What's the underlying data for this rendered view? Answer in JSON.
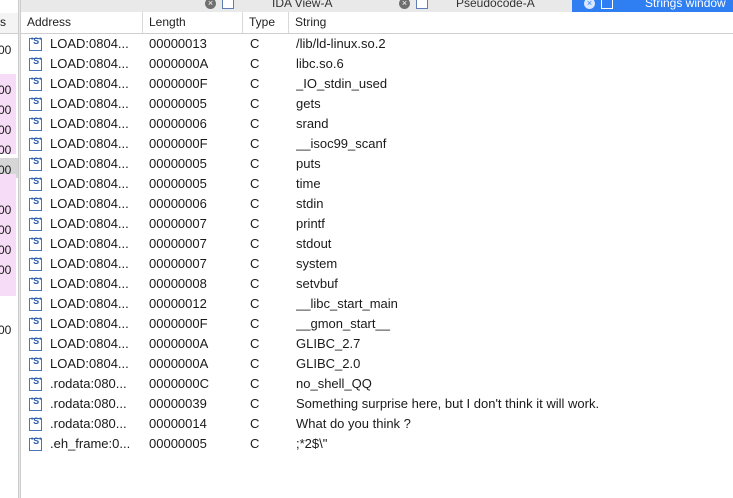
{
  "left_pane": {
    "header_fragment": "s",
    "fragments": [
      "00",
      "00",
      "00",
      "00",
      "00",
      "00",
      "00",
      "00",
      "00",
      "00",
      "00"
    ]
  },
  "tabs": [
    {
      "label": "IDA View-A",
      "close": "×"
    },
    {
      "label": "Pseudocode-A",
      "close": "×"
    },
    {
      "label": "Strings window",
      "close": "×",
      "active": true
    }
  ],
  "columns": {
    "address": "Address",
    "length": "Length",
    "type": "Type",
    "string": "String"
  },
  "rows": [
    {
      "address": "LOAD:0804...",
      "length": "00000013",
      "type": "C",
      "string": "/lib/ld-linux.so.2"
    },
    {
      "address": "LOAD:0804...",
      "length": "0000000A",
      "type": "C",
      "string": "libc.so.6"
    },
    {
      "address": "LOAD:0804...",
      "length": "0000000F",
      "type": "C",
      "string": "_IO_stdin_used"
    },
    {
      "address": "LOAD:0804...",
      "length": "00000005",
      "type": "C",
      "string": "gets"
    },
    {
      "address": "LOAD:0804...",
      "length": "00000006",
      "type": "C",
      "string": "srand"
    },
    {
      "address": "LOAD:0804...",
      "length": "0000000F",
      "type": "C",
      "string": "__isoc99_scanf"
    },
    {
      "address": "LOAD:0804...",
      "length": "00000005",
      "type": "C",
      "string": "puts"
    },
    {
      "address": "LOAD:0804...",
      "length": "00000005",
      "type": "C",
      "string": "time"
    },
    {
      "address": "LOAD:0804...",
      "length": "00000006",
      "type": "C",
      "string": "stdin"
    },
    {
      "address": "LOAD:0804...",
      "length": "00000007",
      "type": "C",
      "string": "printf"
    },
    {
      "address": "LOAD:0804...",
      "length": "00000007",
      "type": "C",
      "string": "stdout"
    },
    {
      "address": "LOAD:0804...",
      "length": "00000007",
      "type": "C",
      "string": "system"
    },
    {
      "address": "LOAD:0804...",
      "length": "00000008",
      "type": "C",
      "string": "setvbuf"
    },
    {
      "address": "LOAD:0804...",
      "length": "00000012",
      "type": "C",
      "string": "__libc_start_main"
    },
    {
      "address": "LOAD:0804...",
      "length": "0000000F",
      "type": "C",
      "string": "__gmon_start__"
    },
    {
      "address": "LOAD:0804...",
      "length": "0000000A",
      "type": "C",
      "string": "GLIBC_2.7"
    },
    {
      "address": "LOAD:0804...",
      "length": "0000000A",
      "type": "C",
      "string": "GLIBC_2.0"
    },
    {
      "address": ".rodata:080...",
      "length": "0000000C",
      "type": "C",
      "string": "no_shell_QQ"
    },
    {
      "address": ".rodata:080...",
      "length": "00000039",
      "type": "C",
      "string": "Something surprise here, but I don't think it will work."
    },
    {
      "address": ".rodata:080...",
      "length": "00000014",
      "type": "C",
      "string": "What do you think ?"
    },
    {
      "address": ".eh_frame:0...",
      "length": "00000005",
      "type": "C",
      "string": ";*2$\\\""
    }
  ],
  "string_icon_glyph": "'S'",
  "colors": {
    "active_tab": "#2f7ff2",
    "pink_highlight": "#f6dcf6",
    "icon_blue": "#4a73b8"
  }
}
